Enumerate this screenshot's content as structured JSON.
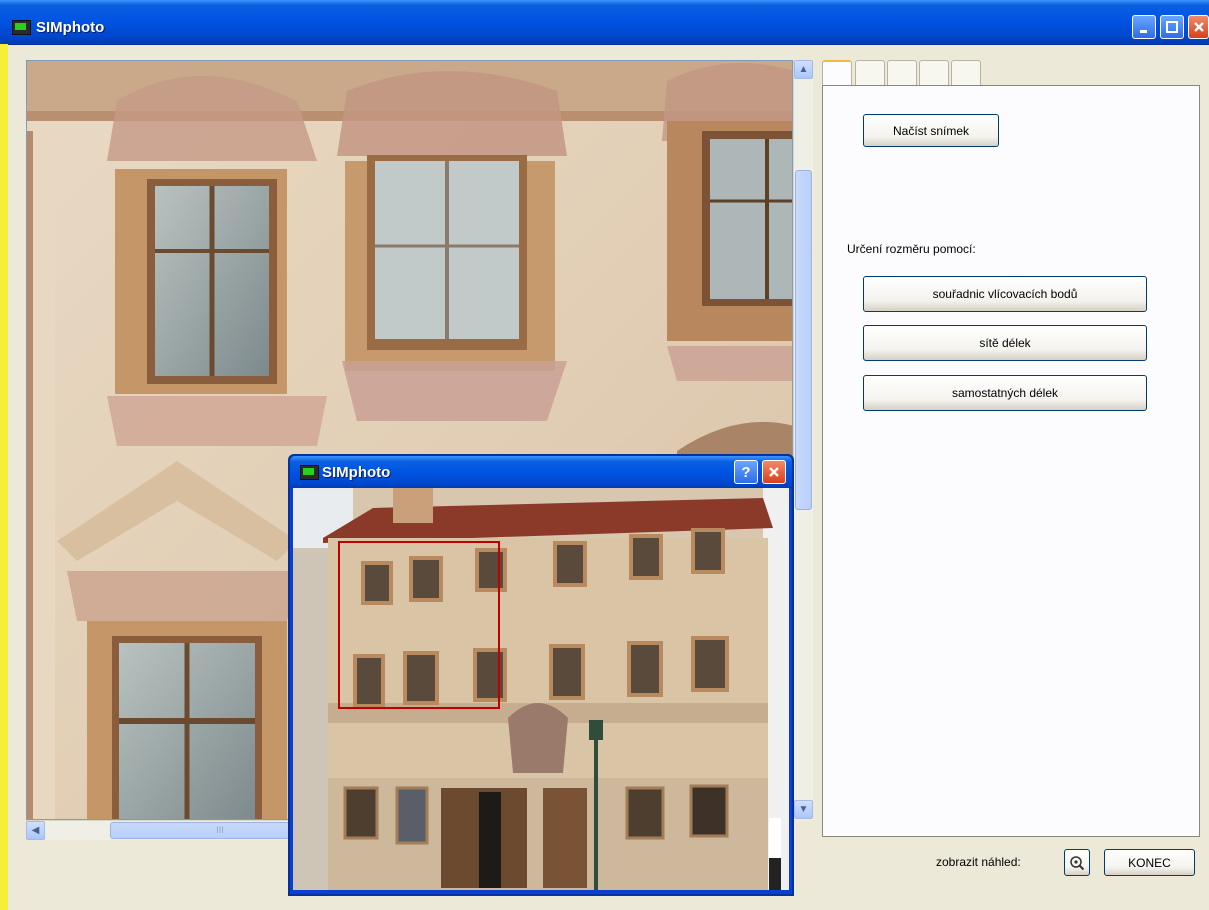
{
  "window": {
    "title": "SIMphoto",
    "accent": "#0054e3"
  },
  "titlebar_buttons": {
    "minimize": "minimize-icon",
    "maximize": "maximize-icon",
    "close": "close-icon"
  },
  "panel": {
    "tabs_count": 5,
    "load_button": "Načíst snímek",
    "section_label": "Určení rozměru pomocí:",
    "buttons": [
      "souřadnic vlícovacích bodů",
      "sítě délek",
      "samostatných délek"
    ]
  },
  "footer": {
    "preview_label": "zobrazit náhled:",
    "zoom_icon": "zoom-icon",
    "end_button": "KONEC"
  },
  "scroll": {
    "h_thumb_grip": "III"
  },
  "preview_dialog": {
    "title": "SIMphoto",
    "help": "?",
    "close": "close-icon"
  }
}
